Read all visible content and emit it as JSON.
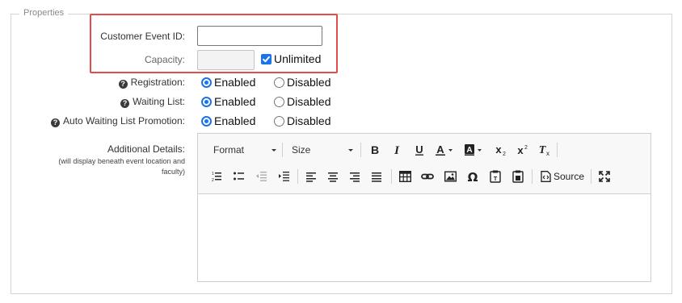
{
  "fieldset": {
    "legend": "Properties"
  },
  "fields": {
    "customer_event_id": {
      "label": "Customer Event ID:",
      "value": "",
      "placeholder": ""
    },
    "capacity": {
      "label": "Capacity:",
      "value": "",
      "unlimited_label": "Unlimited",
      "unlimited_checked": true
    },
    "registration": {
      "label": "Registration:",
      "selected": "Enabled"
    },
    "waiting_list": {
      "label": "Waiting List:",
      "selected": "Enabled"
    },
    "auto_waiting_list_promotion": {
      "label": "Auto Waiting List Promotion:",
      "selected": "Enabled"
    },
    "radio_options": {
      "enabled": "Enabled",
      "disabled": "Disabled"
    },
    "additional_details": {
      "label": "Additional Details:",
      "note": "(will display beneath event location and faculty)",
      "content": ""
    }
  },
  "editor_toolbar": {
    "format_label": "Format",
    "size_label": "Size",
    "source_label": "Source",
    "buttons_row1": [
      "bold-icon",
      "italic-icon",
      "underline-icon",
      "text-color-icon",
      "background-color-icon",
      "subscript-icon",
      "superscript-icon",
      "remove-format-icon"
    ],
    "buttons_row2": [
      "numbered-list-icon",
      "bulleted-list-icon",
      "decrease-indent-icon",
      "increase-indent-icon",
      "align-left-icon",
      "align-center-icon",
      "align-right-icon",
      "justify-icon",
      "table-icon",
      "link-icon",
      "image-icon",
      "special-character-icon",
      "paste-text-icon",
      "paste-word-icon",
      "source-icon",
      "maximize-icon"
    ]
  },
  "colors": {
    "highlight": "#e44b4b",
    "accent": "#1a73e8"
  }
}
